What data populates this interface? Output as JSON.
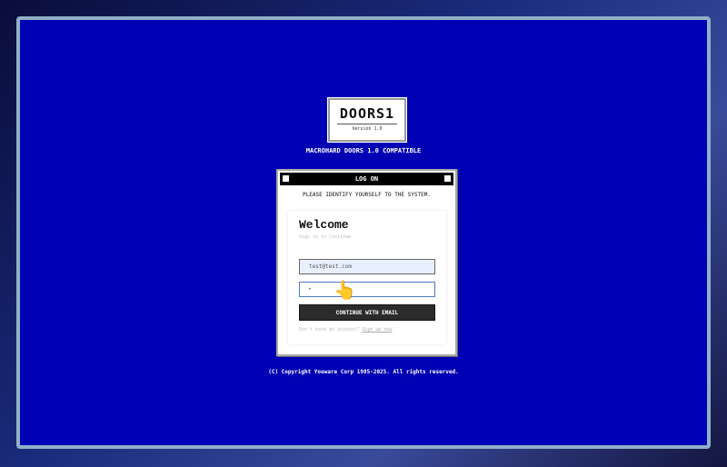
{
  "logo": {
    "title": "DOORS1",
    "version": "Version 1.0"
  },
  "subtitle": "MACROHARD DOORS 1.0 COMPATIBLE",
  "dialog": {
    "title": "LOG ON",
    "message": "PLEASE IDENTIFY YOURSELF TO THE SYSTEM."
  },
  "form": {
    "heading": "Welcome",
    "subheading": "Sign in to Continue",
    "email_value": "test@test.com",
    "password_value": "•",
    "submit_label": "CONTINUE WITH EMAIL",
    "signup_prompt": "Don't have an account?",
    "signup_link": "Sign up now"
  },
  "footer": {
    "copyright": "(C) Copyright Youware Corp 1985-2025. All rights reserved."
  }
}
